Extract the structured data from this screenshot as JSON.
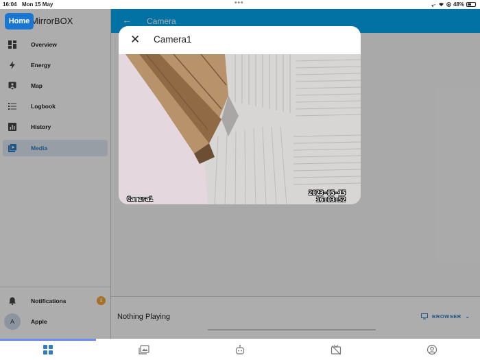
{
  "status_bar": {
    "time": "16:04",
    "date": "Mon 15 May",
    "battery": "48%",
    "battery_level": 0.48
  },
  "home_button": "Home",
  "sidebar": {
    "brand": "MirrorBOX",
    "items": [
      {
        "label": "Overview",
        "icon": "dashboard-icon",
        "active": false
      },
      {
        "label": "Energy",
        "icon": "lightning-icon",
        "active": false
      },
      {
        "label": "Map",
        "icon": "map-icon",
        "active": false
      },
      {
        "label": "Logbook",
        "icon": "list-icon",
        "active": false
      },
      {
        "label": "History",
        "icon": "chart-icon",
        "active": false
      },
      {
        "label": "Media",
        "icon": "media-icon",
        "active": true
      }
    ],
    "notifications": {
      "label": "Notifications",
      "count": "1"
    },
    "user": {
      "initial": "A",
      "name": "Apple"
    }
  },
  "header": {
    "title": "Camera"
  },
  "dialog": {
    "title": "Camera1",
    "overlay_label": "Camera1",
    "overlay_date": "2023-05-15",
    "overlay_time": "16:03:52"
  },
  "player": {
    "status": "Nothing Playing",
    "target": "BROWSER"
  },
  "tabs": [
    {
      "icon": "dashboard-icon",
      "active": true
    },
    {
      "icon": "photos-icon",
      "active": false
    },
    {
      "icon": "robot-icon",
      "active": false
    },
    {
      "icon": "tv-off-icon",
      "active": false
    },
    {
      "icon": "account-icon",
      "active": false
    }
  ],
  "colors": {
    "accent": "#03a9f4",
    "active_nav": "#2f7dc4",
    "home_button": "#1976d2",
    "badge": "#f2a73b"
  }
}
